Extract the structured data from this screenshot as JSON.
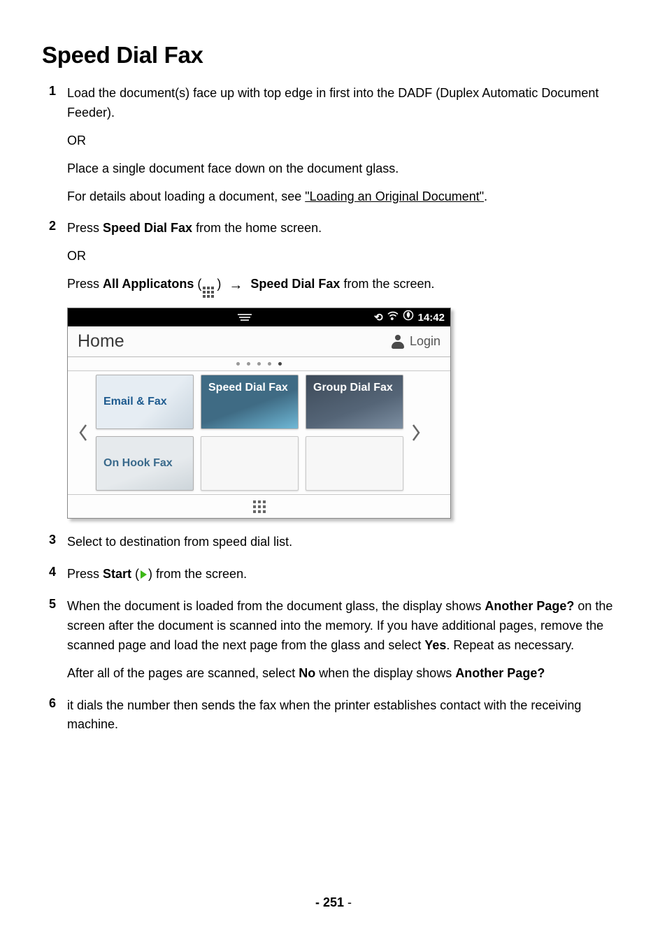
{
  "heading": "Speed Dial Fax",
  "steps": {
    "s1": {
      "num": "1",
      "p1a": "Load the document(s) face up with top edge in first into the DADF (Duplex Automatic Document Feeder).",
      "p1b": "OR",
      "p1c": "Place a single document face down on the document glass.",
      "p1d_prefix": "For details about loading a document, see ",
      "p1d_link": "\"Loading an Original Document\"",
      "p1d_suffix": "."
    },
    "s2": {
      "num": "2",
      "p2a_prefix": "Press ",
      "p2a_bold": "Speed Dial Fax",
      "p2a_suffix": " from the home screen.",
      "p2b": "OR",
      "p2c_prefix": "Press ",
      "p2c_bold1": "All Applicatons",
      "p2c_paren": "(",
      "p2c_paren2": ") ",
      "p2c_bold2": "Speed Dial Fax",
      "p2c_suffix": " from the screen."
    },
    "s3": {
      "num": "3",
      "text": "Select to destination from speed dial list."
    },
    "s4": {
      "num": "4",
      "prefix": "Press ",
      "bold": "Start",
      "paren_open": " (",
      "paren_close": ") ",
      "suffix": "from the screen."
    },
    "s5": {
      "num": "5",
      "p5a_1": "When the document is loaded from the document glass, the display shows ",
      "p5a_b1": "Another Page?",
      "p5a_2": " on the screen after the document is scanned into the memory. If you have additional pages, remove the scanned page and load the next page from the glass and select ",
      "p5a_b2": "Yes",
      "p5a_3": ". Repeat as necessary.",
      "p5b_1": "After all of the pages are scanned, select ",
      "p5b_b1": "No",
      "p5b_2": " when the display shows ",
      "p5b_b2": "Another Page?"
    },
    "s6": {
      "num": "6",
      "text": "it dials the number then sends the fax when the printer establishes contact with the receiving machine."
    }
  },
  "screen": {
    "time": "14:42",
    "home_label": "Home",
    "login_label": "Login",
    "tiles": {
      "email": "Email & Fax",
      "speed": "Speed Dial Fax",
      "group": "Group Dial Fax",
      "hook": "On Hook Fax"
    }
  },
  "page_number": "251"
}
